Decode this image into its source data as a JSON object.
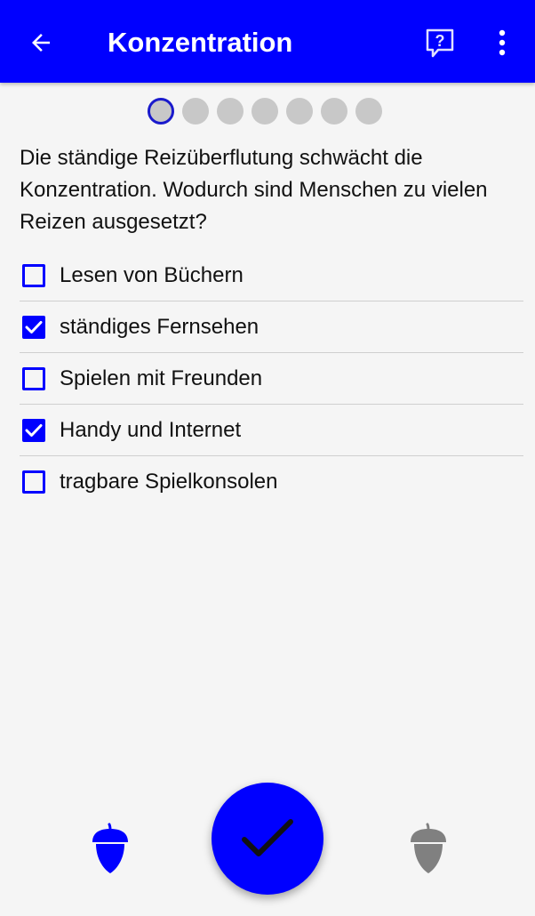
{
  "appbar": {
    "title": "Konzentration",
    "back_icon": "arrow-left-icon",
    "help_icon": "question-bubble-icon",
    "more_icon": "more-vertical-icon",
    "background": "#0000ff"
  },
  "progress": {
    "total_steps": 7,
    "current_step": 1
  },
  "question": {
    "text": "Die ständige Reizüberflutung schwächt die Konzentration. Wodurch sind Menschen zu vielen Reizen ausgesetzt?"
  },
  "options": [
    {
      "label": "Lesen von Büchern",
      "checked": false
    },
    {
      "label": "ständiges Fernsehen",
      "checked": true
    },
    {
      "label": "Spielen mit Freunden",
      "checked": false
    },
    {
      "label": "Handy und Internet",
      "checked": true
    },
    {
      "label": "tragbare Spielkonsolen",
      "checked": false
    }
  ],
  "footer": {
    "left_icon": "acorn-icon",
    "left_color": "#0000ff",
    "submit_icon": "checkmark-icon",
    "right_icon": "acorn-icon",
    "right_color": "#808080"
  }
}
